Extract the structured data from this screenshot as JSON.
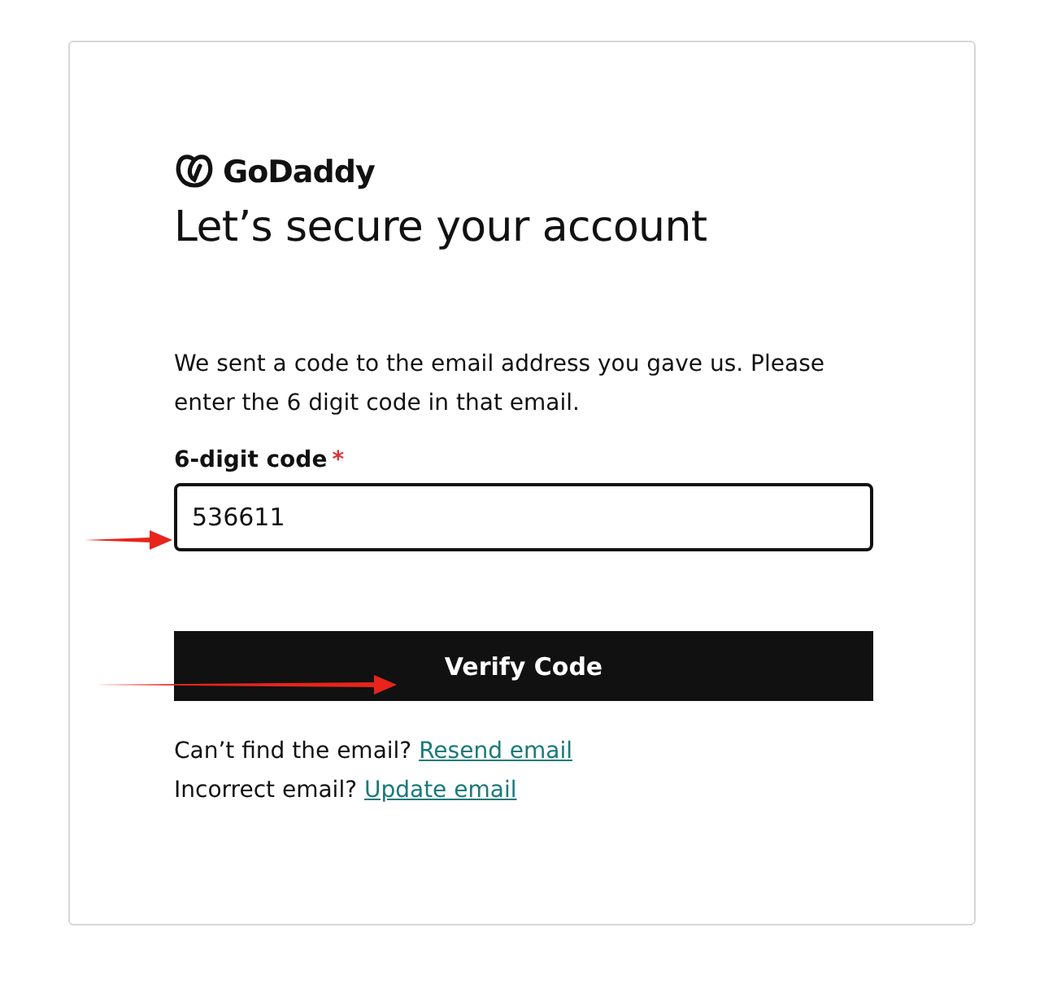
{
  "logo": {
    "text": "GoDaddy"
  },
  "title": "Let’s secure your account",
  "message": "We sent a code to the email address you gave us. Please enter the 6 digit code in that email.",
  "code_field": {
    "label": "6-digit code",
    "required_mark": "*",
    "value": "536611"
  },
  "verify_button": "Verify Code",
  "help_lines": [
    {
      "text": "Can’t find the email?",
      "link": "Resend email"
    },
    {
      "text": "Incorrect email?",
      "link": "Update email"
    }
  ]
}
